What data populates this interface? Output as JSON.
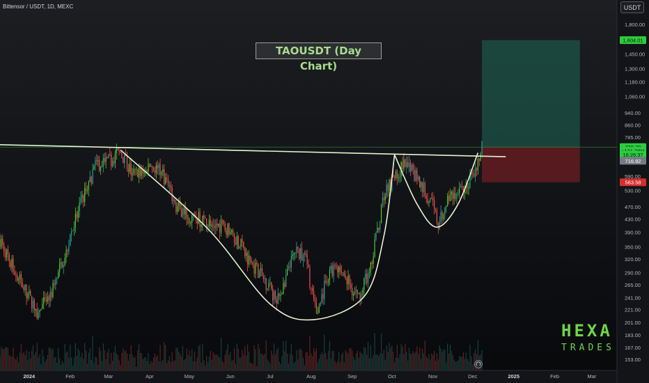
{
  "header": {
    "pair_title": "Bittensor / USDT, 1D, MEXC",
    "currency_button": "USDT"
  },
  "logo": {
    "text_top": "HEXA",
    "text_bottom": "TRADES"
  },
  "icons": {
    "replay": "replay-icon"
  },
  "colors": {
    "up": "#26a69a",
    "up_bright": "#4ecb3a",
    "down": "#ef5350",
    "pattern_line": "#e6f3cf",
    "target_zone": "#1e6a55",
    "stop_zone": "#6e1d22",
    "accent": "#6fd54a"
  },
  "chart_data": {
    "type": "candlestick",
    "title": "TAOUSDT (Day Chart)",
    "pattern": "cup and handle",
    "y_scale": "log",
    "ylim": [
      150,
      1820
    ],
    "xlim": [
      "2023-12-10",
      "2025-03-20"
    ],
    "grid": false,
    "y_ticks": [
      1800,
      1450,
      1300,
      1180,
      1060,
      940,
      860,
      785,
      590,
      530,
      470,
      430,
      390,
      350,
      320,
      290,
      265,
      241,
      221,
      201,
      183,
      167,
      153
    ],
    "x_ticks": [
      {
        "label": "2024",
        "date": "2024-01-01"
      },
      {
        "label": "Feb",
        "date": "2024-02-01"
      },
      {
        "label": "Mar",
        "date": "2024-03-01"
      },
      {
        "label": "Apr",
        "date": "2024-04-01"
      },
      {
        "label": "May",
        "date": "2024-05-01"
      },
      {
        "label": "Jun",
        "date": "2024-06-01"
      },
      {
        "label": "Jul",
        "date": "2024-07-01"
      },
      {
        "label": "Aug",
        "date": "2024-08-01"
      },
      {
        "label": "Sep",
        "date": "2024-09-01"
      },
      {
        "label": "Oct",
        "date": "2024-10-01"
      },
      {
        "label": "Nov",
        "date": "2024-11-01"
      },
      {
        "label": "Dec",
        "date": "2024-12-01"
      },
      {
        "label": "2025",
        "date": "2025-01-01"
      },
      {
        "label": "Feb",
        "date": "2025-02-01"
      },
      {
        "label": "Mar",
        "date": "2025-03-01"
      }
    ],
    "price_key_points": [
      {
        "date": "2023-12-10",
        "price": 370
      },
      {
        "date": "2023-12-20",
        "price": 300
      },
      {
        "date": "2023-12-30",
        "price": 250
      },
      {
        "date": "2024-01-08",
        "price": 215
      },
      {
        "date": "2024-01-20",
        "price": 260
      },
      {
        "date": "2024-02-05",
        "price": 430
      },
      {
        "date": "2024-02-20",
        "price": 640
      },
      {
        "date": "2024-03-01",
        "price": 660
      },
      {
        "date": "2024-03-10",
        "price": 700
      },
      {
        "date": "2024-03-20",
        "price": 590
      },
      {
        "date": "2024-04-01",
        "price": 640
      },
      {
        "date": "2024-04-11",
        "price": 600
      },
      {
        "date": "2024-04-20",
        "price": 480
      },
      {
        "date": "2024-05-01",
        "price": 440
      },
      {
        "date": "2024-05-15",
        "price": 420
      },
      {
        "date": "2024-06-01",
        "price": 400
      },
      {
        "date": "2024-06-15",
        "price": 320
      },
      {
        "date": "2024-07-01",
        "price": 260
      },
      {
        "date": "2024-07-06",
        "price": 230
      },
      {
        "date": "2024-07-20",
        "price": 340
      },
      {
        "date": "2024-07-28",
        "price": 320
      },
      {
        "date": "2024-08-05",
        "price": 210
      },
      {
        "date": "2024-08-15",
        "price": 300
      },
      {
        "date": "2024-08-25",
        "price": 290
      },
      {
        "date": "2024-09-05",
        "price": 240
      },
      {
        "date": "2024-09-15",
        "price": 300
      },
      {
        "date": "2024-09-25",
        "price": 520
      },
      {
        "date": "2024-10-01",
        "price": 570
      },
      {
        "date": "2024-10-10",
        "price": 640
      },
      {
        "date": "2024-10-20",
        "price": 590
      },
      {
        "date": "2024-11-01",
        "price": 470
      },
      {
        "date": "2024-11-05",
        "price": 410
      },
      {
        "date": "2024-11-12",
        "price": 500
      },
      {
        "date": "2024-11-20",
        "price": 520
      },
      {
        "date": "2024-11-28",
        "price": 560
      },
      {
        "date": "2024-12-05",
        "price": 640
      },
      {
        "date": "2024-12-08",
        "price": 730
      }
    ],
    "neckline": [
      {
        "date": "2023-12-10",
        "price": 743
      },
      {
        "date": "2024-12-26",
        "price": 680
      }
    ],
    "cup_points": [
      {
        "date": "2024-03-10",
        "price": 715
      },
      {
        "date": "2024-05-15",
        "price": 400
      },
      {
        "date": "2024-07-01",
        "price": 230
      },
      {
        "date": "2024-08-03",
        "price": 205
      },
      {
        "date": "2024-09-10",
        "price": 243
      },
      {
        "date": "2024-09-25",
        "price": 380
      },
      {
        "date": "2024-10-03",
        "price": 690
      }
    ],
    "handle_points": [
      {
        "date": "2024-10-03",
        "price": 690
      },
      {
        "date": "2024-10-20",
        "price": 480
      },
      {
        "date": "2024-11-04",
        "price": 405
      },
      {
        "date": "2024-11-20",
        "price": 480
      },
      {
        "date": "2024-12-05",
        "price": 700
      }
    ],
    "position": {
      "entry": 730.2,
      "target": 1604.01,
      "stop": 563.58,
      "start_date": "2024-12-08",
      "end_date": "2025-02-20"
    },
    "price_labels": [
      {
        "text": "1,604.01",
        "price": 1604.01,
        "bg": "#2ecc40",
        "fg": "#0b1a0b"
      },
      {
        "text": "730.20",
        "price": 730.2,
        "bg": "#2ecc40",
        "fg": "#0b1a0b"
      },
      {
        "text": "+121.28%",
        "price": 710,
        "bg": "#2ecc40",
        "fg": "#0b1a0b"
      },
      {
        "text": "16:26:37",
        "price": 690,
        "bg": "#2ecc40",
        "fg": "#0b1a0b"
      },
      {
        "text": "716.92",
        "price": 660,
        "bg": "#787b86",
        "fg": "#ffffff"
      },
      {
        "text": "563.58",
        "price": 563.58,
        "bg": "#d32f2f",
        "fg": "#ffffff"
      }
    ]
  }
}
